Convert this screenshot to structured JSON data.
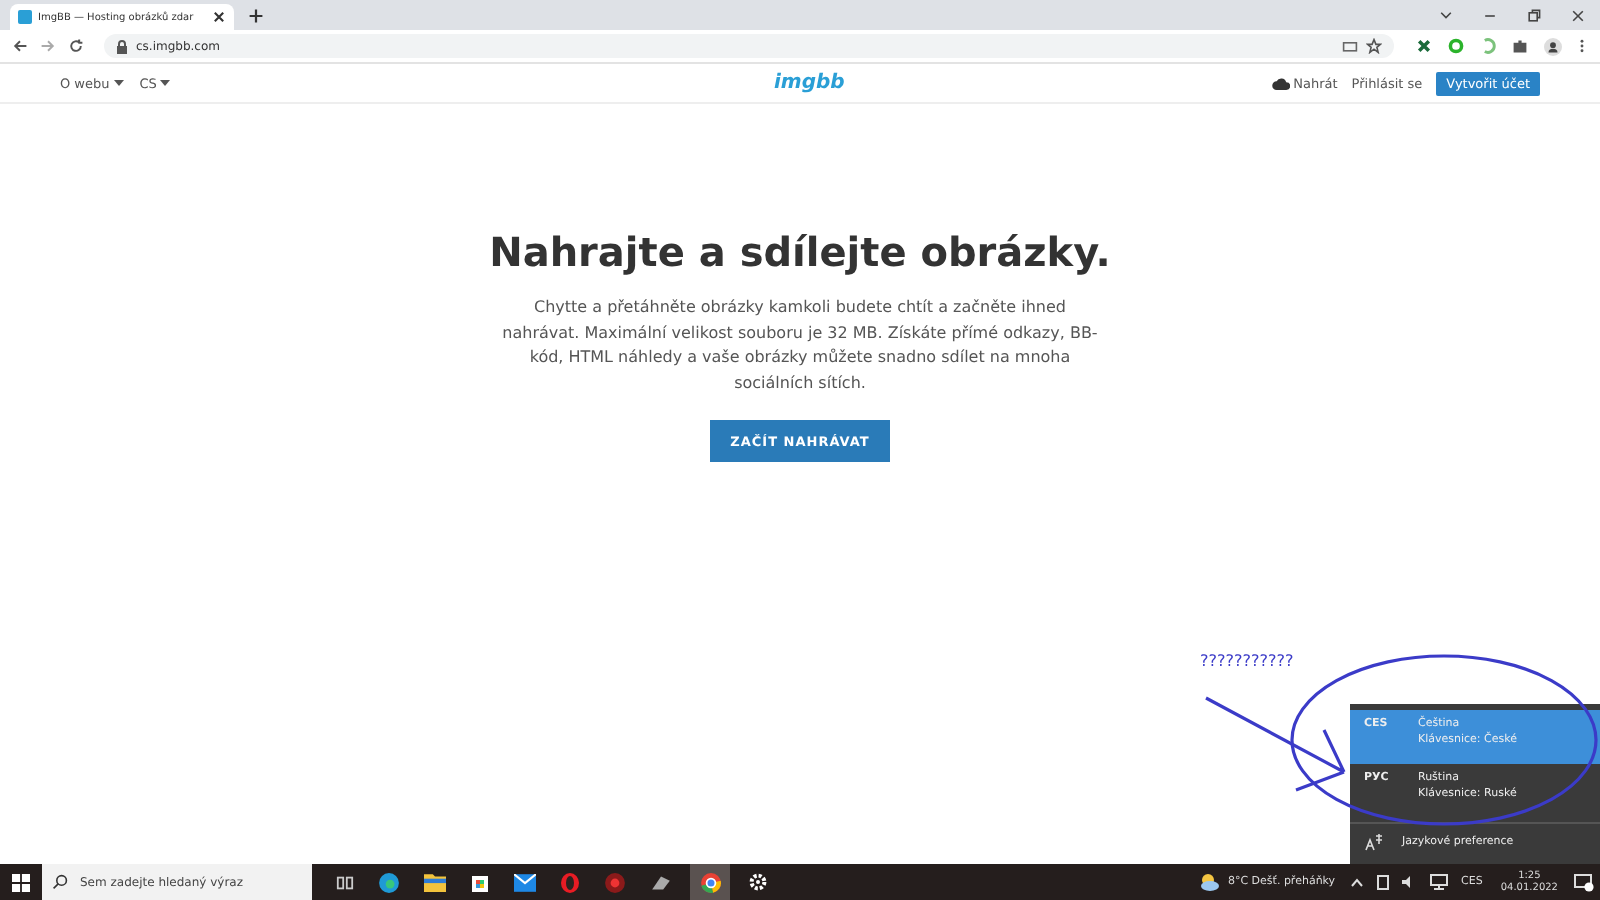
{
  "browser": {
    "tab_title": "ImgBB — Hosting obrázků zdar",
    "url": "cs.imgbb.com"
  },
  "site_nav": {
    "left": [
      {
        "label": "O webu"
      },
      {
        "label": "CS"
      }
    ],
    "logo": "imgbb",
    "upload": "Nahrát",
    "login": "Přihlásit se",
    "signup": "Vytvořit účet"
  },
  "hero": {
    "title": "Nahrajte a sdílejte obrázky.",
    "text": "Chytte a přetáhněte obrázky kamkoli budete chtít a začněte ihned nahrávat. Maximální velikost souboru je 32 MB. Získáte přímé odkazy, BB-kód, HTML náhledy a vaše obrázky můžete snadno sdílet na mnoha sociálních sítích.",
    "button": "ZAČÍT NAHRÁVAT"
  },
  "annotation": {
    "text": "???????????"
  },
  "language_flyout": {
    "languages": [
      {
        "code": "CES",
        "name": "Čeština",
        "keyboard": "Klávesnice: České",
        "selected": true
      },
      {
        "code": "PУС",
        "name": "Ruština",
        "keyboard": "Klávesnice: Ruské",
        "selected": false
      }
    ],
    "preferences": "Jazykové preference"
  },
  "taskbar": {
    "search_placeholder": "Sem zadejte hledaný výraz",
    "weather": "8°C  Dešť. přeháňky",
    "language": "CES",
    "time": "1:25",
    "date": "04.01.2022"
  }
}
